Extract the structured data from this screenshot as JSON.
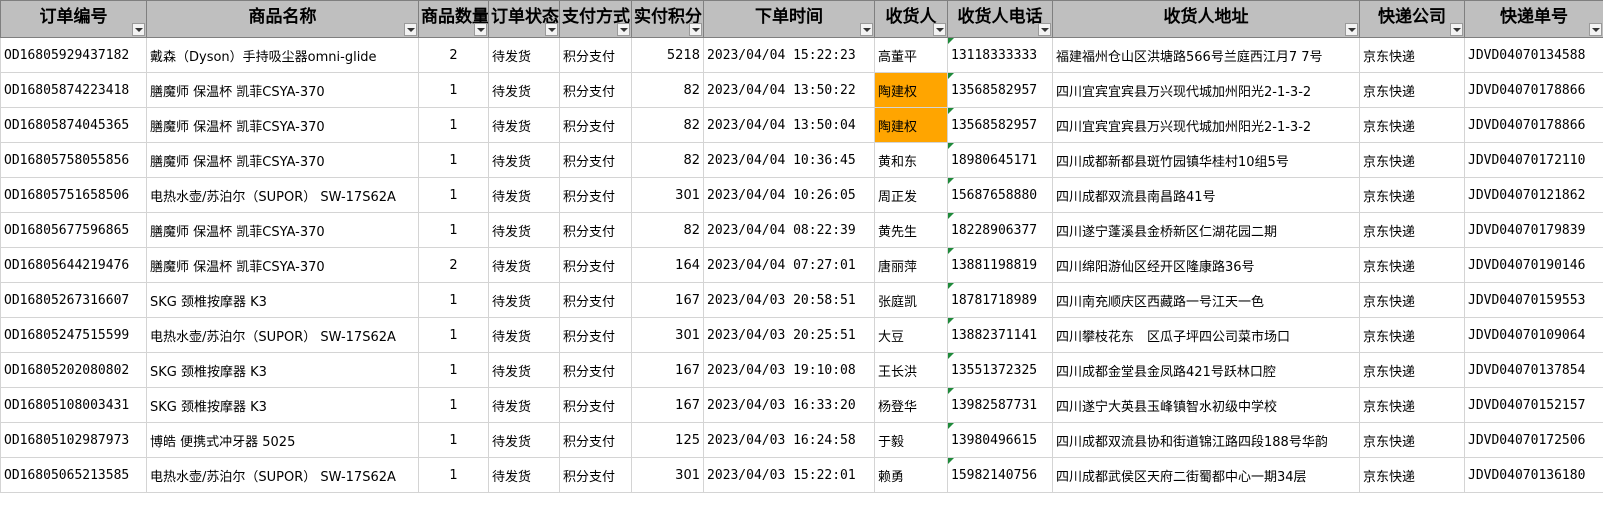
{
  "columns": [
    {
      "key": "order_id",
      "label": "订单编号"
    },
    {
      "key": "product",
      "label": "商品名称"
    },
    {
      "key": "qty",
      "label": "商品数量"
    },
    {
      "key": "status",
      "label": "订单状态"
    },
    {
      "key": "payment",
      "label": "支付方式"
    },
    {
      "key": "points",
      "label": "实付积分"
    },
    {
      "key": "time",
      "label": "下单时间"
    },
    {
      "key": "receiver",
      "label": "收货人"
    },
    {
      "key": "phone",
      "label": "收货人电话"
    },
    {
      "key": "address",
      "label": "收货人地址"
    },
    {
      "key": "courier",
      "label": "快递公司"
    },
    {
      "key": "tracking",
      "label": "快递单号"
    }
  ],
  "highlight_color": "#ffa500",
  "comment_marker_color": "#1e8a3a",
  "rows": [
    {
      "order_id": "OD16805929437182",
      "product": "戴森（Dyson）手持吸尘器omni-glide",
      "qty": "2",
      "status": "待发货",
      "payment": "积分支付",
      "points": "5218",
      "time": "2023/04/04 15:22:23",
      "receiver": "高董平",
      "phone": "13118333333",
      "address": "福建福州仓山区洪塘路566号兰庭西江月7 7号",
      "courier": "京东快递",
      "tracking": "JDVD04070134588",
      "highlight": false
    },
    {
      "order_id": "OD16805874223418",
      "product": "膳魔师 保温杯 凯菲CSYA-370",
      "qty": "1",
      "status": "待发货",
      "payment": "积分支付",
      "points": "82",
      "time": "2023/04/04 13:50:22",
      "receiver": "陶建权",
      "phone": "13568582957",
      "address": "四川宜宾宜宾县万兴现代城加州阳光2-1-3-2",
      "courier": "京东快递",
      "tracking": "JDVD04070178866",
      "highlight": true
    },
    {
      "order_id": "OD16805874045365",
      "product": "膳魔师 保温杯 凯菲CSYA-370",
      "qty": "1",
      "status": "待发货",
      "payment": "积分支付",
      "points": "82",
      "time": "2023/04/04 13:50:04",
      "receiver": "陶建权",
      "phone": "13568582957",
      "address": "四川宜宾宜宾县万兴现代城加州阳光2-1-3-2",
      "courier": "京东快递",
      "tracking": "JDVD04070178866",
      "highlight": true
    },
    {
      "order_id": "OD16805758055856",
      "product": "膳魔师 保温杯 凯菲CSYA-370",
      "qty": "1",
      "status": "待发货",
      "payment": "积分支付",
      "points": "82",
      "time": "2023/04/04 10:36:45",
      "receiver": "黄和东",
      "phone": "18980645171",
      "address": "四川成都新都县斑竹园镇华桂村10组5号",
      "courier": "京东快递",
      "tracking": "JDVD04070172110",
      "highlight": false
    },
    {
      "order_id": "OD16805751658506",
      "product": "电热水壶/苏泊尔（SUPOR） SW-17S62A",
      "qty": "1",
      "status": "待发货",
      "payment": "积分支付",
      "points": "301",
      "time": "2023/04/04 10:26:05",
      "receiver": "周正发",
      "phone": "15687658880",
      "address": "四川成都双流县南昌路41号",
      "courier": "京东快递",
      "tracking": "JDVD04070121862",
      "highlight": false
    },
    {
      "order_id": "OD16805677596865",
      "product": "膳魔师 保温杯 凯菲CSYA-370",
      "qty": "1",
      "status": "待发货",
      "payment": "积分支付",
      "points": "82",
      "time": "2023/04/04 08:22:39",
      "receiver": "黄先生",
      "phone": "18228906377",
      "address": "四川遂宁蓬溪县金桥新区仁湖花园二期",
      "courier": "京东快递",
      "tracking": "JDVD04070179839",
      "highlight": false
    },
    {
      "order_id": "OD16805644219476",
      "product": "膳魔师 保温杯 凯菲CSYA-370",
      "qty": "2",
      "status": "待发货",
      "payment": "积分支付",
      "points": "164",
      "time": "2023/04/04 07:27:01",
      "receiver": "唐丽萍",
      "phone": "13881198819",
      "address": "四川绵阳游仙区经开区隆康路36号",
      "courier": "京东快递",
      "tracking": "JDVD04070190146",
      "highlight": false
    },
    {
      "order_id": "OD16805267316607",
      "product": "SKG 颈椎按摩器 K3",
      "qty": "1",
      "status": "待发货",
      "payment": "积分支付",
      "points": "167",
      "time": "2023/04/03 20:58:51",
      "receiver": "张庭凯",
      "phone": "18781718989",
      "address": "四川南充顺庆区西藏路一号江天一色",
      "courier": "京东快递",
      "tracking": "JDVD04070159553",
      "highlight": false
    },
    {
      "order_id": "OD16805247515599",
      "product": "电热水壶/苏泊尔（SUPOR） SW-17S62A",
      "qty": "1",
      "status": "待发货",
      "payment": "积分支付",
      "points": "301",
      "time": "2023/04/03 20:25:51",
      "receiver": "大豆",
      "phone": "13882371141",
      "address": "四川攀枝花东　区瓜子坪四公司菜市场口",
      "courier": "京东快递",
      "tracking": "JDVD04070109064",
      "highlight": false
    },
    {
      "order_id": "OD16805202080802",
      "product": "SKG 颈椎按摩器 K3",
      "qty": "1",
      "status": "待发货",
      "payment": "积分支付",
      "points": "167",
      "time": "2023/04/03 19:10:08",
      "receiver": "王长洪",
      "phone": "13551372325",
      "address": "四川成都金堂县金凤路421号跃林口腔",
      "courier": "京东快递",
      "tracking": "JDVD04070137854",
      "highlight": false
    },
    {
      "order_id": "OD16805108003431",
      "product": "SKG 颈椎按摩器 K3",
      "qty": "1",
      "status": "待发货",
      "payment": "积分支付",
      "points": "167",
      "time": "2023/04/03 16:33:20",
      "receiver": "杨登华",
      "phone": "13982587731",
      "address": "四川遂宁大英县玉峰镇智水初级中学校",
      "courier": "京东快递",
      "tracking": "JDVD04070152157",
      "highlight": false
    },
    {
      "order_id": "OD16805102987973",
      "product": "博皓 便携式冲牙器 5025",
      "qty": "1",
      "status": "待发货",
      "payment": "积分支付",
      "points": "125",
      "time": "2023/04/03 16:24:58",
      "receiver": "于毅",
      "phone": "13980496615",
      "address": "四川成都双流县协和街道锦江路四段188号华韵",
      "courier": "京东快递",
      "tracking": "JDVD04070172506",
      "highlight": false
    },
    {
      "order_id": "OD16805065213585",
      "product": "电热水壶/苏泊尔（SUPOR） SW-17S62A",
      "qty": "1",
      "status": "待发货",
      "payment": "积分支付",
      "points": "301",
      "time": "2023/04/03 15:22:01",
      "receiver": "赖勇",
      "phone": "15982140756",
      "address": "四川成都武侯区天府二街蜀都中心一期34层",
      "courier": "京东快递",
      "tracking": "JDVD04070136180",
      "highlight": false
    }
  ]
}
